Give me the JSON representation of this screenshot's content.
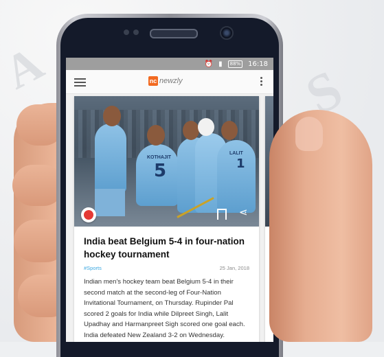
{
  "status_bar": {
    "time": "16:18",
    "battery": "88%"
  },
  "app": {
    "logo_mark": "nc",
    "logo_text": "newzly"
  },
  "article": {
    "title": "India beat Belgium 5-4 in four-nation hockey tournament",
    "tag": "#Sports",
    "date": "25 Jan, 2018",
    "summary": "Indian men's hockey team beat Belgium 5-4 in their second match at the second-leg of Four-Nation Invitational Tournament, on Thursday. Rupinder Pal scored 2 goals for India while Dilpreet Singh, Lalit Upadhay and Harmanpreet Sigh scored one goal each. India defeated New Zealand 3-2 on Wednesday.",
    "jerseys": {
      "main_name": "KOTHAJIT",
      "main_number": "5",
      "right_name": "LALIT",
      "right_number": "1"
    }
  },
  "colors": {
    "accent": "#f26a21",
    "tag": "#3aa7e0",
    "category_badge": "#e53935"
  }
}
